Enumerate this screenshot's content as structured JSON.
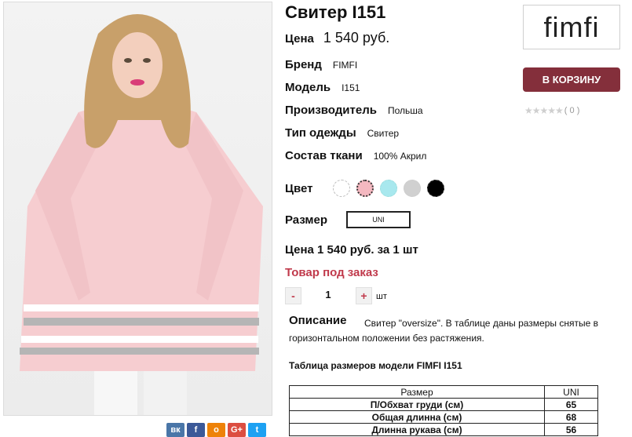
{
  "product": {
    "title": "Свитер I151",
    "price_label": "Цена",
    "price_value": "1 540 руб."
  },
  "attributes": [
    {
      "label": "Бренд",
      "value": "FIMFI"
    },
    {
      "label": "Модель",
      "value": "I151"
    },
    {
      "label": "Производитель",
      "value": "Польша"
    },
    {
      "label": "Тип одежды",
      "value": "Свитер"
    },
    {
      "label": "Состав ткани",
      "value": "100% Акрил"
    }
  ],
  "color": {
    "label": "Цвет",
    "swatches": [
      "#ffffff",
      "#f4b8c0",
      "#a8e8ee",
      "#d0d0d0",
      "#000000"
    ]
  },
  "size": {
    "label": "Размер",
    "option": "UNI"
  },
  "unit_price": "Цена 1 540 руб. за 1 шт",
  "availability": "Товар под заказ",
  "quantity": {
    "minus": "-",
    "value": "1",
    "plus": "+",
    "unit": "шт"
  },
  "description": {
    "title": "Описание",
    "text": "Свитер \"oversize\". В таблице даны размеры снятые в горизонтальном положении без растяжения."
  },
  "size_table": {
    "title": "Таблица размеров модели FIMFI  I151",
    "headers": [
      "Размер",
      "UNI"
    ],
    "rows": [
      [
        "П/Обхват груди (см)",
        "65"
      ],
      [
        "Общая длинна (см)",
        "68"
      ],
      [
        "Длинна рукава (см)",
        "56"
      ]
    ]
  },
  "brand_logo": "fimfi",
  "cart_button": "В КОРЗИНУ",
  "rating": {
    "stars": "★★★★★",
    "count": "( 0 )"
  },
  "social": [
    {
      "icon": "vk-icon",
      "glyph": "вк",
      "color": "#4a76a8"
    },
    {
      "icon": "facebook-icon",
      "glyph": "f",
      "color": "#3b5998"
    },
    {
      "icon": "odnoklassniki-icon",
      "glyph": "о",
      "color": "#ee8208"
    },
    {
      "icon": "google-plus-icon",
      "glyph": "G+",
      "color": "#dc4e41"
    },
    {
      "icon": "twitter-icon",
      "glyph": "t",
      "color": "#1da1f2"
    }
  ]
}
